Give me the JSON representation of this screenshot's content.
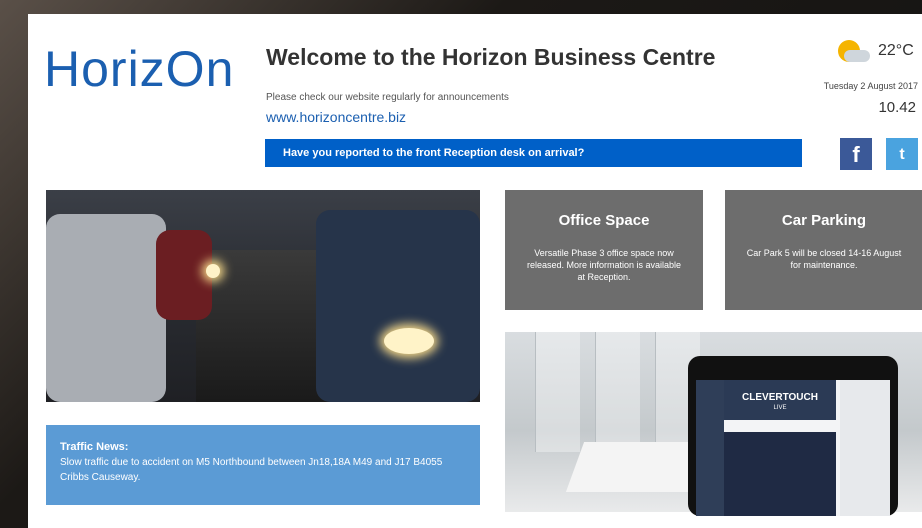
{
  "header": {
    "logo": "HorizOn",
    "welcome": "Welcome to the Horizon Business Centre",
    "subtext": "Please check our website regularly for announcements",
    "url": "www.horizoncentre.biz",
    "banner": "Have you reported to the front Reception desk on arrival?"
  },
  "status": {
    "temperature": "22°C",
    "date": "Tuesday 2 August 2017",
    "time": "10.42"
  },
  "social": {
    "facebook": "f",
    "twitter": "t"
  },
  "traffic": {
    "title": "Traffic News:",
    "body": "Slow traffic due to accident on M5 Northbound between Jn18,18A M49 and J17 B4055 Cribbs Causeway."
  },
  "tiles": [
    {
      "title": "Office Space",
      "body": "Versatile Phase 3 office space now released. More information is available at Reception."
    },
    {
      "title": "Car Parking",
      "body": "Car Park 5 will be closed 14-16 August for maintenance."
    }
  ],
  "tablet": {
    "brand": "CLEVERTOUCH",
    "sub": "LIVE"
  },
  "colors": {
    "brand_blue": "#1b5fb0",
    "banner_blue": "#0060c8",
    "tile_grey": "#6d6d6d",
    "traffic_blue": "#5b9bd5"
  }
}
